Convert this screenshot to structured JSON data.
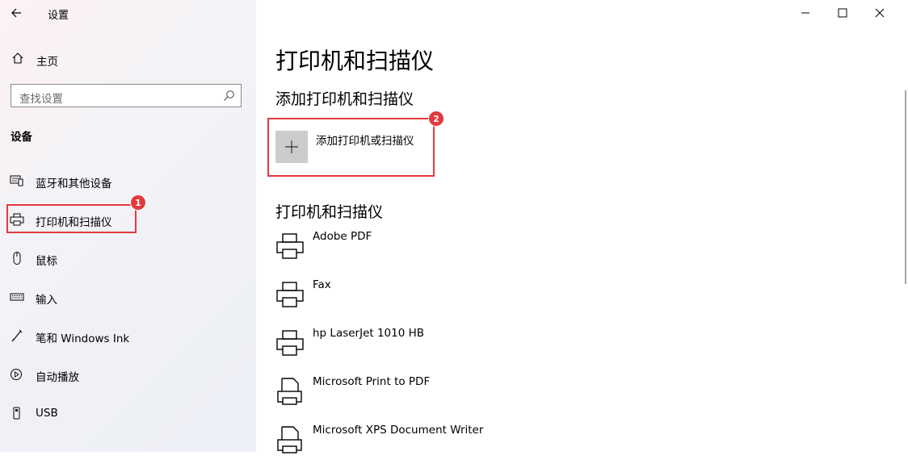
{
  "window": {
    "title": "设置",
    "controls": [
      "minimize",
      "maximize",
      "close"
    ]
  },
  "sidebar": {
    "home_label": "主页",
    "search_placeholder": "查找设置",
    "section_title": "设备",
    "items": [
      {
        "label": "蓝牙和其他设备",
        "icon": "bluetooth-devices-icon"
      },
      {
        "label": "打印机和扫描仪",
        "icon": "printer-icon"
      },
      {
        "label": "鼠标",
        "icon": "mouse-icon"
      },
      {
        "label": "输入",
        "icon": "keyboard-icon"
      },
      {
        "label": "笔和 Windows Ink",
        "icon": "pen-icon"
      },
      {
        "label": "自动播放",
        "icon": "autoplay-icon"
      },
      {
        "label": "USB",
        "icon": "usb-icon"
      }
    ]
  },
  "annotations": {
    "badge_1": "1",
    "badge_2": "2",
    "accent": "#e4393c"
  },
  "main": {
    "page_title": "打印机和扫描仪",
    "add_section_title": "添加打印机和扫描仪",
    "add_button_label": "添加打印机或扫描仪",
    "list_section_title": "打印机和扫描仪",
    "printers": [
      {
        "name": "Adobe PDF",
        "icon": "printer-icon"
      },
      {
        "name": "Fax",
        "icon": "printer-icon"
      },
      {
        "name": "hp LaserJet 1010 HB",
        "icon": "printer-icon"
      },
      {
        "name": "Microsoft Print to PDF",
        "icon": "document-printer-icon"
      },
      {
        "name": "Microsoft XPS Document Writer",
        "icon": "document-printer-icon"
      }
    ]
  }
}
